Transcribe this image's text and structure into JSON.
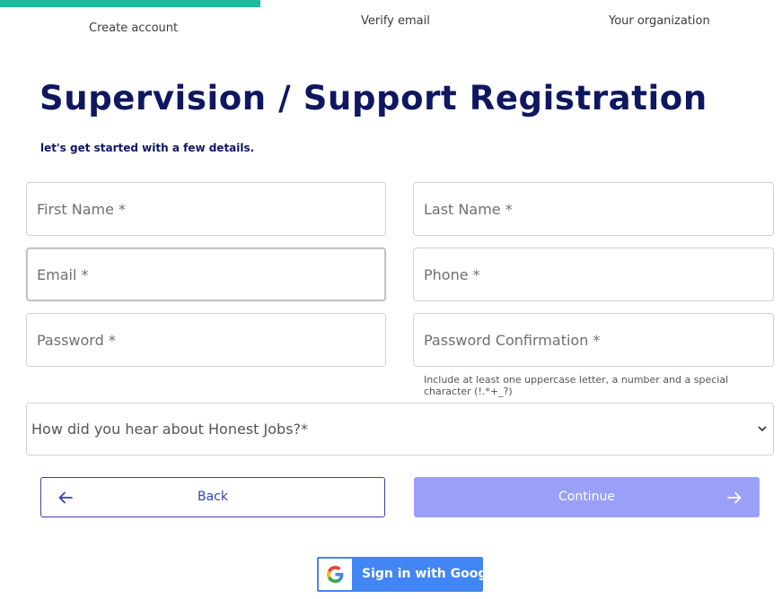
{
  "steps": [
    {
      "label": "Create account",
      "active": true
    },
    {
      "label": "Verify email",
      "active": false
    },
    {
      "label": "Your organization",
      "active": false
    }
  ],
  "colors": {
    "progress": "#1dbb99",
    "heading": "#0f1761",
    "primary": "#3a3fb5",
    "continue_disabled": "#9aa0f7",
    "google_blue": "#4285f4"
  },
  "heading": {
    "title": "Supervision / Support Registration",
    "subtitle": "let's get started with a few details."
  },
  "form": {
    "first_name": {
      "placeholder": "First Name *",
      "value": ""
    },
    "last_name": {
      "placeholder": "Last Name *",
      "value": ""
    },
    "email": {
      "placeholder": "Email *",
      "value": ""
    },
    "phone": {
      "placeholder": "Phone *",
      "value": ""
    },
    "password": {
      "placeholder": "Password *",
      "value": ""
    },
    "password_confirmation": {
      "placeholder": "Password Confirmation *",
      "value": ""
    },
    "password_hint": "Include at least one uppercase letter, a number and a special character (!.*+_?)",
    "referral": {
      "selected": "How did you hear about Honest Jobs?*"
    }
  },
  "actions": {
    "back_label": "Back",
    "continue_label": "Continue",
    "google_label": "Sign in with Google"
  },
  "icons": {
    "back": "arrow-left-icon",
    "continue": "arrow-right-icon",
    "select": "chevron-down-icon",
    "google": "google-logo-icon"
  }
}
